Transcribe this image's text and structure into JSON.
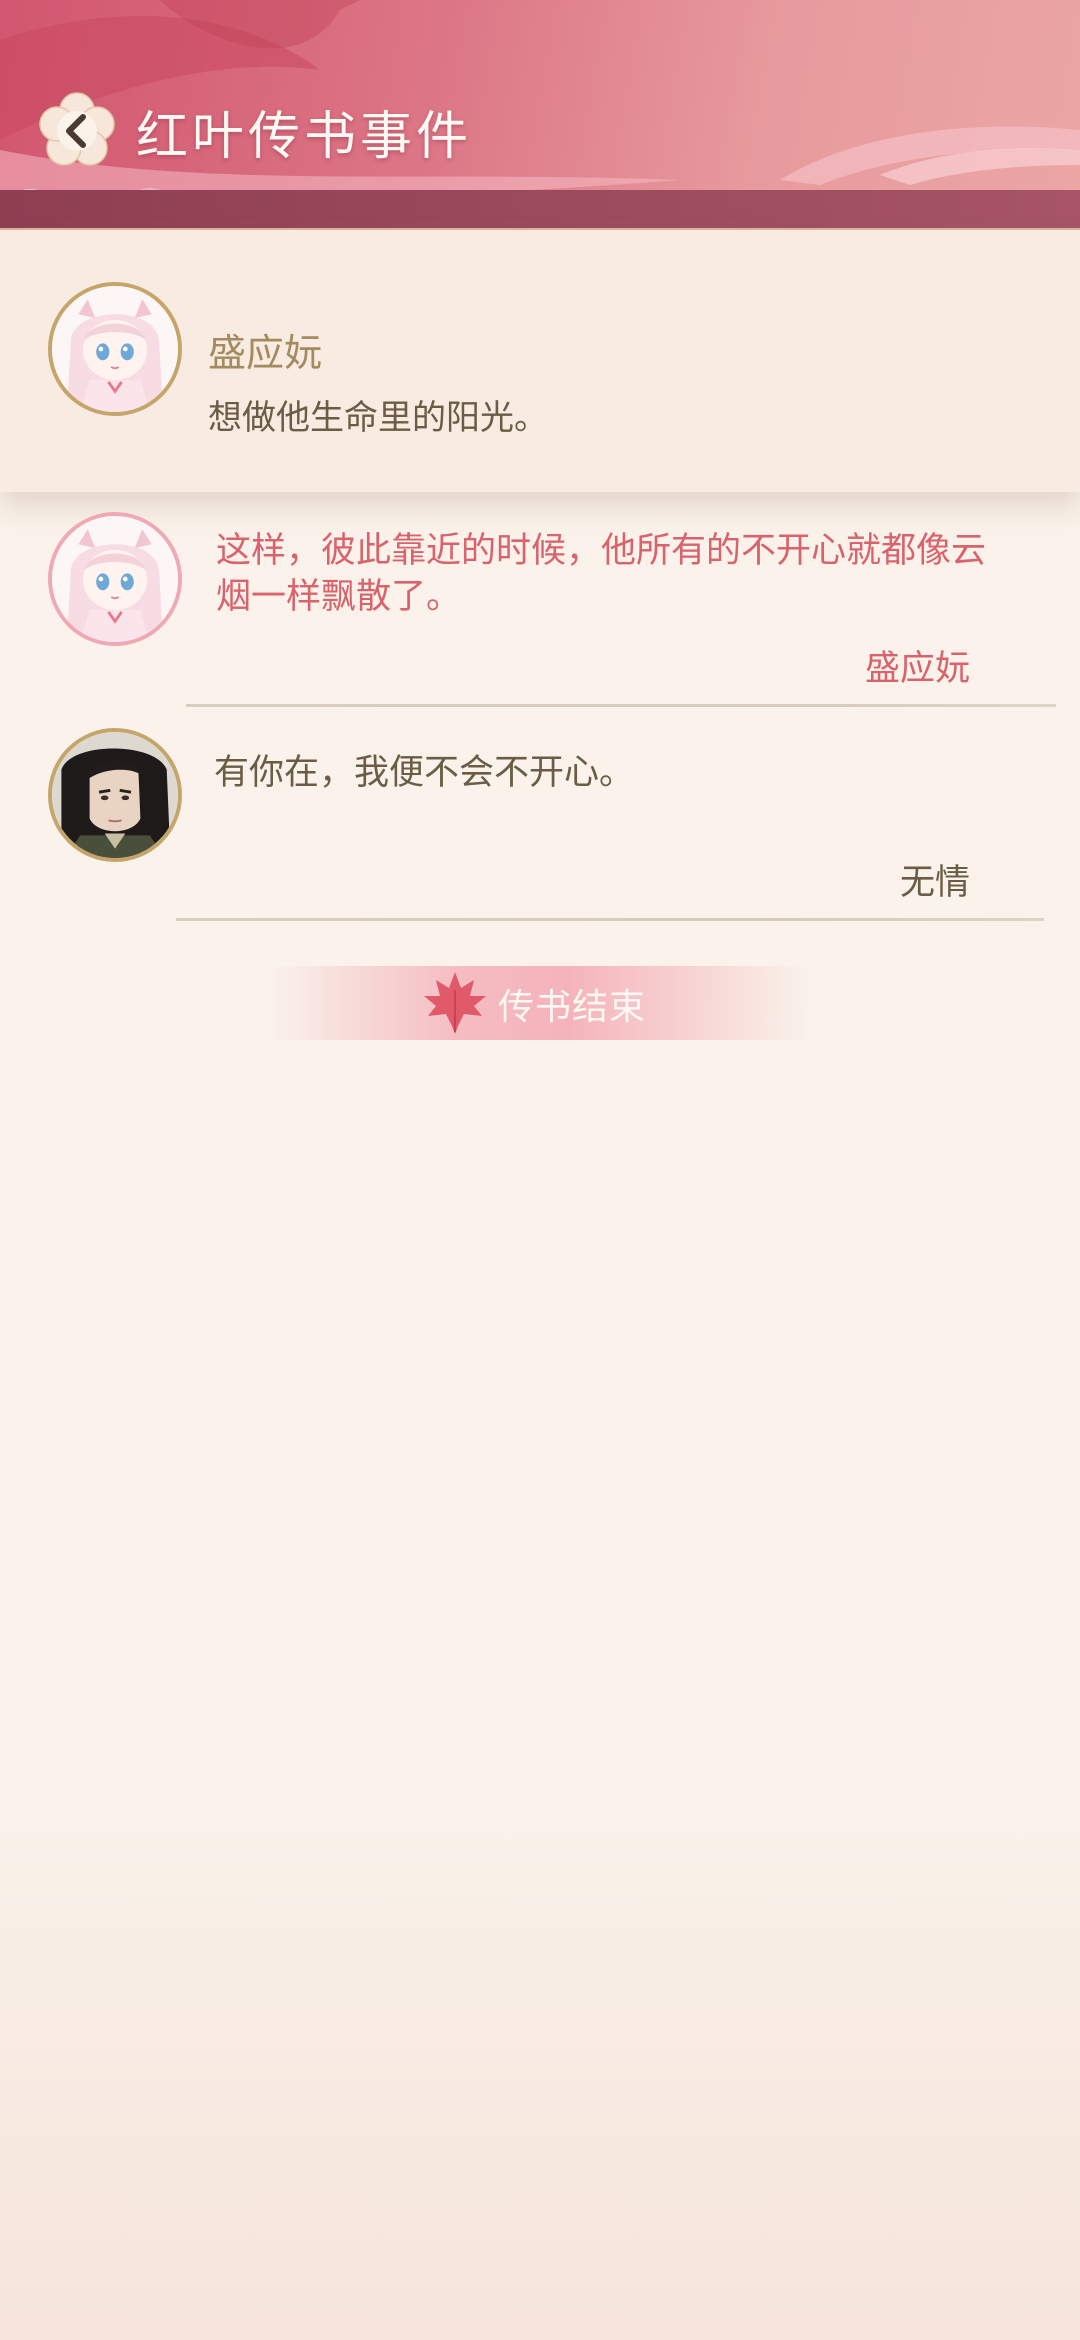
{
  "header": {
    "title": "红叶传书事件"
  },
  "profile": {
    "name": "盛应妧",
    "motto": "想做他生命里的阳光。",
    "avatar_icon": "anime-girl-avatar-icon"
  },
  "messages": [
    {
      "text": "这样，彼此靠近的时候，他所有的不开心就都像云烟一样飘散了。",
      "sender": "盛应妧",
      "avatar_icon": "anime-girl-avatar-icon",
      "color": "#d9636c"
    },
    {
      "text": "有你在，我便不会不开心。",
      "sender": "无情",
      "avatar_icon": "dark-haired-man-avatar-icon",
      "color": "#6b5c45"
    }
  ],
  "end": {
    "label": "传书结束",
    "icon": "maple-leaf-icon"
  },
  "colors": {
    "header_pink": "#d2566f",
    "accent_pink": "#d9636c",
    "text_brown": "#6b5c45",
    "name_gold": "#a58a5e",
    "background": "#faf2ea"
  }
}
